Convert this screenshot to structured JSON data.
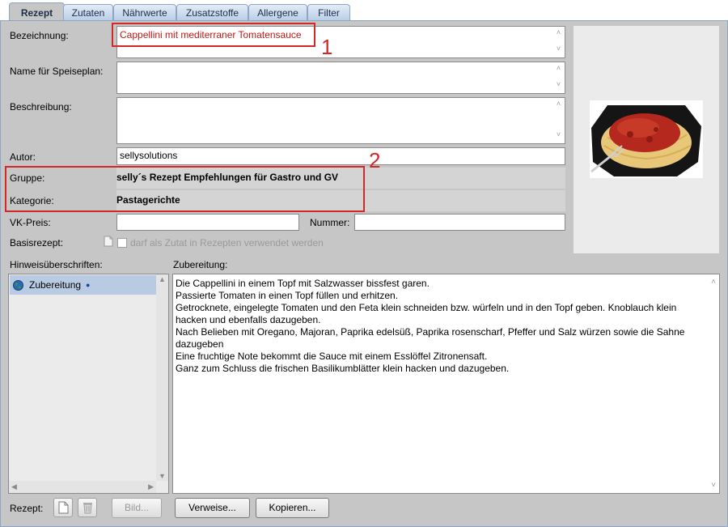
{
  "tabs": [
    {
      "label": "Rezept",
      "active": true
    },
    {
      "label": "Zutaten"
    },
    {
      "label": "Nährwerte"
    },
    {
      "label": "Zusatzstoffe"
    },
    {
      "label": "Allergene"
    },
    {
      "label": "Filter"
    }
  ],
  "form": {
    "bezeichnung_label": "Bezeichnung:",
    "bezeichnung_value": "Cappellini mit mediterraner Tomatensauce",
    "speiseplan_label": "Name für Speiseplan:",
    "speiseplan_value": "",
    "beschreibung_label": "Beschreibung:",
    "beschreibung_value": "",
    "autor_label": "Autor:",
    "autor_value": "sellysolutions",
    "gruppe_label": "Gruppe:",
    "gruppe_value": "selly´s  Rezept Empfehlungen für Gastro und GV",
    "kategorie_label": "Kategorie:",
    "kategorie_value": "Pastagerichte",
    "vkpreis_label": "VK-Preis:",
    "vkpreis_value": "",
    "nummer_label": "Nummer:",
    "nummer_value": "",
    "basisrezept_label": "Basisrezept:",
    "basisrezept_checkbox_label": "darf als Zutat in Rezepten verwendet werden"
  },
  "callouts": {
    "one": "1",
    "two": "2"
  },
  "hinweis": {
    "label": "Hinweisüberschriften:",
    "items": [
      "Zubereitung"
    ]
  },
  "zubereitung": {
    "label": "Zubereitung:",
    "lines": [
      "Die Cappellini in einem Topf mit Salzwasser bissfest garen.",
      "",
      "Passierte Tomaten in einen Topf füllen und erhitzen.",
      "Getrocknete, eingelegte Tomaten und den Feta klein schneiden bzw. würfeln und in den Topf geben. Knoblauch klein hacken und ebenfalls dazugeben.",
      "",
      "Nach Belieben mit Oregano, Majoran, Paprika edelsüß, Paprika rosenscharf, Pfeffer und Salz würzen sowie die Sahne dazugeben",
      "Eine fruchtige Note bekommt die Sauce mit einem Esslöffel Zitronensaft.",
      "",
      "Ganz zum Schluss die frischen Basilikumblätter klein hacken und dazugeben."
    ]
  },
  "bottom": {
    "rezept_label": "Rezept:",
    "bild_button": "Bild...",
    "verweise_button": "Verweise...",
    "kopieren_button": "Kopieren..."
  },
  "colors": {
    "accent_red": "#d42828",
    "panel_bg": "#c6c6c6",
    "selection_bg": "#b9cbe2"
  }
}
